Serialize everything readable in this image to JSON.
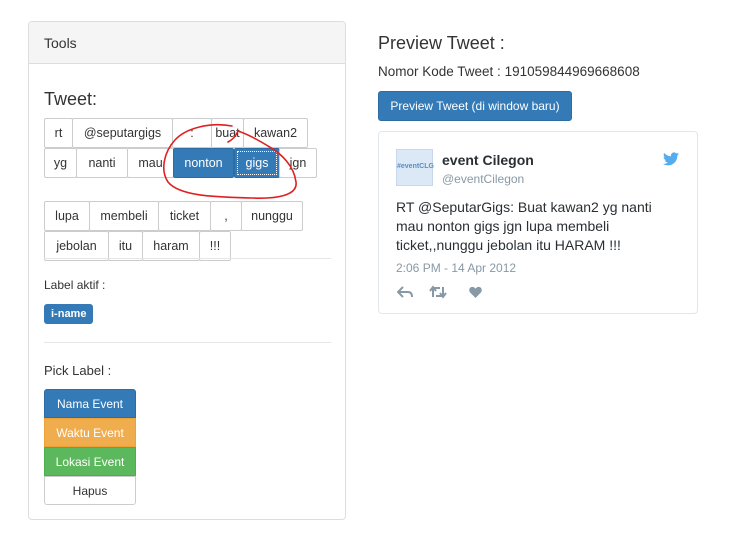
{
  "tools": {
    "heading": "Tools",
    "tweet_title": "Tweet:",
    "words": [
      "rt",
      "@seputargigs",
      ":",
      "buat",
      "kawan2",
      "yg",
      "nanti",
      "mau",
      "nonton",
      "gigs",
      "jgn",
      "lupa",
      "membeli",
      "ticket",
      ",",
      "nunggu",
      "jebolan",
      "itu",
      "haram",
      "!!!"
    ],
    "selected_words": [
      "nonton",
      "gigs"
    ],
    "label_aktif_title": "Label aktif :",
    "active_label": "i-name",
    "pick_label_title": "Pick Label :",
    "pick_labels": [
      "Nama Event",
      "Waktu Event",
      "Lokasi Event",
      "Hapus"
    ]
  },
  "preview": {
    "title": "Preview Tweet :",
    "nomor": "Nomor Kode Tweet : 191059844969668608",
    "button_label": "Preview Tweet (di window baru)"
  },
  "tweet_card": {
    "avatar_text": "#eventCLG",
    "author_name": "event Cilegon",
    "author_handle": "@eventCilegon",
    "text": "RT @SeputarGigs: Buat kawan2 yg nanti mau nonton gigs jgn lupa membeli ticket,,nunggu jebolan itu HARAM !!!",
    "date": "2:06 PM - 14 Apr 2012"
  },
  "colors": {
    "primary": "#337ab7",
    "warning": "#f0ad4e",
    "success": "#5cb85c",
    "twitter": "#55acee",
    "annotation": "#e02020"
  }
}
